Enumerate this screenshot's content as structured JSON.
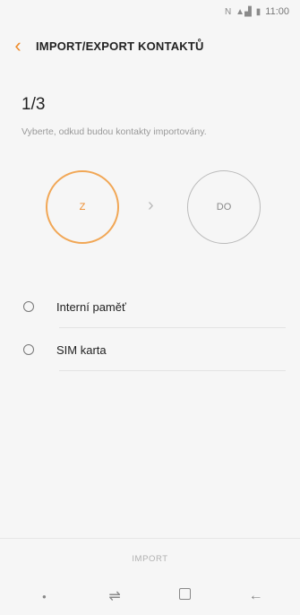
{
  "status_bar": {
    "time": "11:00",
    "icons": [
      "nfc-icon",
      "signal-icon",
      "battery-icon"
    ]
  },
  "header": {
    "title": "IMPORT/EXPORT KONTAKTŮ",
    "back_icon": "chevron-left-icon"
  },
  "wizard": {
    "step": "1/3",
    "hint": "Vyberte, odkud budou kontakty importovány.",
    "from_label": "Z",
    "to_label": "DO",
    "arrow_icon": "chevron-right-icon"
  },
  "options": [
    {
      "label": "Interní paměť"
    },
    {
      "label": "SIM karta"
    }
  ],
  "footer": {
    "import_label": "IMPORT"
  },
  "nav_bar": {
    "icons": [
      "dot-icon",
      "recent-apps-icon",
      "home-icon",
      "back-icon"
    ]
  },
  "colors": {
    "accent": "#ee8a29",
    "background": "#f6f6f6"
  }
}
